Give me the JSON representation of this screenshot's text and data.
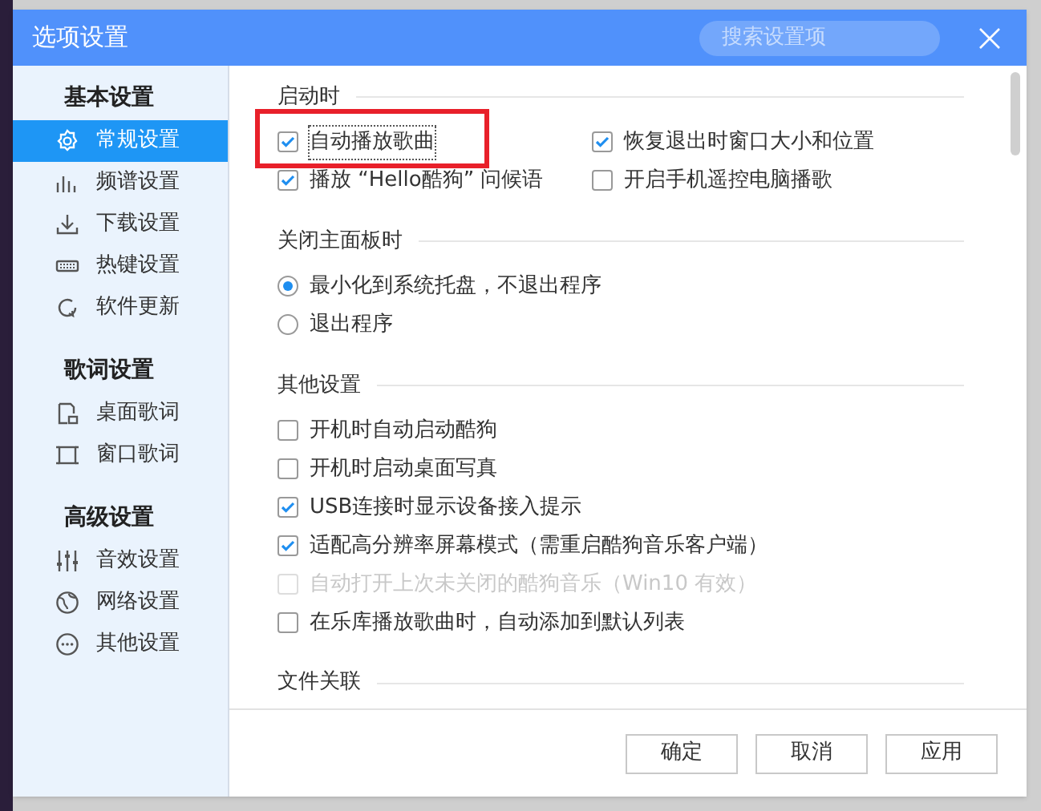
{
  "window": {
    "title": "选项设置",
    "search": {
      "placeholder": "搜索设置项"
    }
  },
  "sidebar": [
    {
      "heading": "基本设置",
      "items": [
        {
          "label": "常规设置",
          "selected": true
        },
        {
          "label": "频谱设置",
          "selected": false
        },
        {
          "label": "下载设置",
          "selected": false
        },
        {
          "label": "热键设置",
          "selected": false
        },
        {
          "label": "软件更新",
          "selected": false
        }
      ]
    },
    {
      "heading": "歌词设置",
      "items": [
        {
          "label": "桌面歌词",
          "selected": false
        },
        {
          "label": "窗口歌词",
          "selected": false
        }
      ]
    },
    {
      "heading": "高级设置",
      "items": [
        {
          "label": "音效设置",
          "selected": false
        },
        {
          "label": "网络设置",
          "selected": false
        },
        {
          "label": "其他设置",
          "selected": false
        }
      ]
    }
  ],
  "sections": [
    {
      "title": "启动时",
      "kind": "grid",
      "items": [
        {
          "label": "自动播放歌曲",
          "checked": true,
          "highlighted": true
        },
        {
          "label": "恢复退出时窗口大小和位置",
          "checked": true,
          "highlighted": false
        },
        {
          "label": "播放 “Hello酷狗” 问候语",
          "checked": true,
          "highlighted": false
        },
        {
          "label": "开启手机遥控电脑播歌",
          "checked": false,
          "highlighted": false
        }
      ]
    },
    {
      "title": "关闭主面板时",
      "kind": "radio",
      "items": [
        {
          "label": "最小化到系统托盘，不退出程序",
          "selected": true
        },
        {
          "label": "退出程序",
          "selected": false
        }
      ]
    },
    {
      "title": "其他设置",
      "kind": "list",
      "items": [
        {
          "label": "开机时自动启动酷狗",
          "checked": false,
          "disabled": false
        },
        {
          "label": "开机时启动桌面写真",
          "checked": false,
          "disabled": false
        },
        {
          "label": "USB连接时显示设备接入提示",
          "checked": true,
          "disabled": false
        },
        {
          "label": "适配高分辨率屏幕模式（需重启酷狗音乐客户端）",
          "checked": true,
          "disabled": false
        },
        {
          "label": "自动打开上次未关闭的酷狗音乐（Win10 有效）",
          "checked": false,
          "disabled": true
        },
        {
          "label": "在乐库播放歌曲时，自动添加到默认列表",
          "checked": false,
          "disabled": false
        }
      ]
    },
    {
      "title": "文件关联",
      "kind": "list"
    }
  ],
  "buttons": [
    "确定",
    "取消",
    "应用"
  ]
}
